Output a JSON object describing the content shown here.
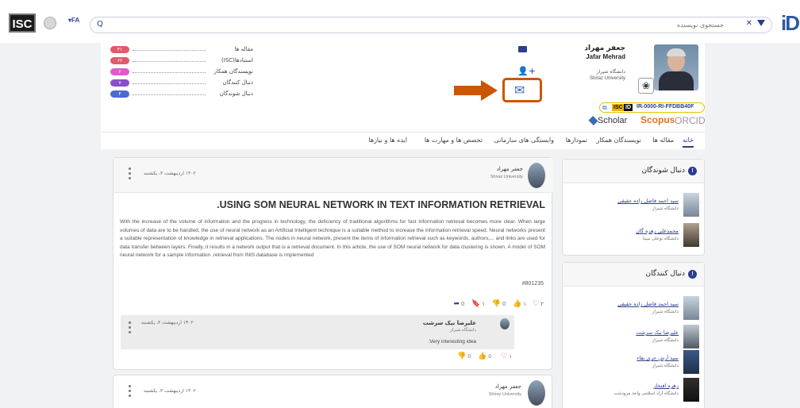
{
  "topbar": {
    "logo": "ISC",
    "lang": "FA",
    "search_placeholder": "جستجوی نویسنده",
    "brand": "iD"
  },
  "profile": {
    "name_fa": "جعفر مهراد",
    "name_en": "Jafar Mehrad",
    "university_fa": "دانشگاه شیراز",
    "university_en": "Shiraz University",
    "isc_label": "ISC",
    "id_label": "ID",
    "isc_id": "IR-0000-RI-FFDBB40F",
    "scholar_label": "Scholar",
    "scopus_label": "Scopus",
    "orcid_label": "ORCID",
    "stats": [
      {
        "label": "مقاله ها",
        "value": "۳۱",
        "color": "#e05a6a"
      },
      {
        "label": "استنادها(ISC)",
        "value": "۶۲",
        "color": "#e05a6a"
      },
      {
        "label": "نویسندگان همکار",
        "value": "۶",
        "color": "#e05ac8"
      },
      {
        "label": "دنبال کنندگان",
        "value": "۷",
        "color": "#8a4ec8"
      },
      {
        "label": "دنبال شوندگان",
        "value": "۴",
        "color": "#4a6ad0"
      }
    ]
  },
  "tabs": [
    {
      "label": "خانه",
      "active": true
    },
    {
      "label": "مقاله ها"
    },
    {
      "label": "نویسندگان همکار"
    },
    {
      "label": "نمودارها"
    },
    {
      "label": "وابستگی های سازمانی"
    },
    {
      "label": "تخصص ها و مهارت ها"
    },
    {
      "label": "ایده ها و نیازها"
    }
  ],
  "post": {
    "author": "جعفر مهراد",
    "author_sub": "Shiraz University",
    "date": "۱۴۰۲ اردیبهشت ۳، یکشنبه",
    "title": ".USING SOM NEURAL NETWORK IN TEXT INFORMATION RETRIEVAL",
    "body": "With the increase of the volume of information and the progress in technology, the deficiency of traditional algorithms for fast information retrieval becomes more clear. When large volumes of data are to be handled, the use of neural network as an Artificial Intelligent technique is a suitable method to increase the information retrieval speed. Neural networks present a suitable representation of knowledge in retrieval applications. The nodes in neural network, present the items of information retrieval such as keywords, authors,... and links are used for data transfer between layers. Finally, it results in a network output that is a retrieval document. In this article, the use of SOM neural network for data clustering is shown. A model of SOM neural network for a sample information .retrieval from INIS database is implemented",
    "hashtag": "#801235",
    "hearts": "۲",
    "likes": "۱",
    "dislikes": "0",
    "bookmarks": "۱",
    "shares": "0",
    "comment": {
      "author": "علیرضا نیک سرشت",
      "author_sub": "دانشگاه شیراز",
      "date": "۱۴۰۲ اردیبهشت ۳، یکشنبه",
      "text": ".Very interesting idea",
      "hearts": "۱",
      "likes": "0",
      "dislikes": "0"
    }
  },
  "post2": {
    "author": "جعفر مهراد",
    "author_sub": "Shiraz University",
    "date": "۱۴۰۲ اردیبهشت ۳، یکشنبه"
  },
  "following": {
    "title": "دنبال شوندگان",
    "items": [
      {
        "name": "سید احمد فاضل زاده حقیقی",
        "sub": "دانشگاه شیراز"
      },
      {
        "name": "محمدعلی زهره گان",
        "sub": "دانشگاه بوعلی سینا"
      }
    ]
  },
  "followers": {
    "title": "دنبال کنندگان",
    "items": [
      {
        "name": "سید احمد فاضل زاده حقیقی",
        "sub": "دانشگاه شیراز"
      },
      {
        "name": "علیرضا نیک سرشت",
        "sub": "دانشگاه شیراز"
      },
      {
        "name": "سید آرش حری نقاء",
        "sub": "دانشگاه شیراز"
      },
      {
        "name": "زهره افتخار",
        "sub": "دانشگاه آزاد اسلامی واحد مرودشت"
      }
    ]
  }
}
